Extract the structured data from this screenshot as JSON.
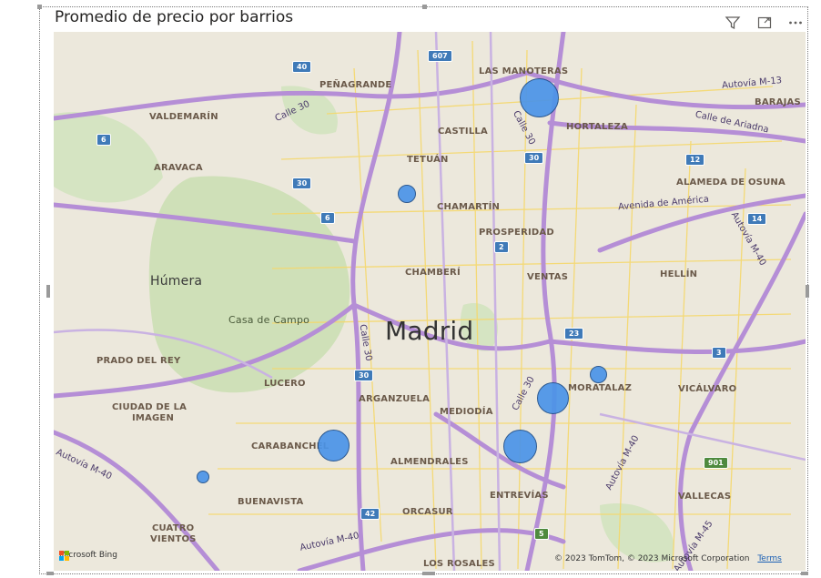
{
  "visual": {
    "title": "Promedio de precio por barrios",
    "header_icons": [
      "filter-icon",
      "focus-mode-icon",
      "more-options-icon"
    ]
  },
  "map": {
    "city_label": "Madrid",
    "place_labels": {
      "humera": "Húmera",
      "casa_de_campo": "Casa de Campo"
    },
    "districts": {
      "penagrande": "PEÑAGRANDE",
      "las_manoteras": "LAS MANOTERAS",
      "valdemarin": "VALDEMARÍN",
      "castilla": "CASTILLA",
      "hortaleza": "HORTALEZA",
      "aravaca": "ARAVACA",
      "tetuan": "TETUÁN",
      "barajas": "BARAJAS",
      "alameda_de_osuna": "ALAMEDA DE OSUNA",
      "chamartin": "CHAMARTÍN",
      "prosperidad": "PROSPERIDAD",
      "chamberi": "CHAMBERÍ",
      "ventas": "VENTAS",
      "hellin": "HELLÍN",
      "prado_del_rey": "PRADO DEL REY",
      "lucero": "LUCERO",
      "moratalaz": "MORATALAZ",
      "vicalvaro": "VICÁLVARO",
      "arganzuela": "ARGANZUELA",
      "ciudad_de_la_imagen_1": "CIUDAD DE LA",
      "ciudad_de_la_imagen_2": "IMAGEN",
      "mediodia": "MEDIODÍA",
      "carabanchel": "CARABANCHEL",
      "almendrales": "ALMENDRALES",
      "entrevias": "ENTREVÍAS",
      "buenavista": "BUENAVISTA",
      "vallecas": "VALLECAS",
      "orcasur": "ORCASUR",
      "cuatro_vientos_1": "CUATRO",
      "cuatro_vientos_2": "VIENTOS",
      "los_rosales": "LOS ROSALES"
    },
    "road_names": {
      "calle30_nw": "Calle 30",
      "calle30_ne": "Calle 30",
      "calle30_center": "Calle 30",
      "calle30_se": "Calle 30",
      "autovia_m13": "Autovía M-13",
      "calle_ariadna": "Calle de Ariadna",
      "avenida_america": "Avenida de América",
      "autovia_m40_e": "Autovía M-40",
      "autovia_m40_w": "Autovía M-40",
      "autovia_m40_s": "Autovía M-40",
      "autovia_m40_se": "Autovía M-40",
      "autovia_m45": "Autovía M-45"
    },
    "shields": {
      "s607": "607",
      "s40": "40",
      "s6a": "6",
      "s30a": "30",
      "s30b": "30",
      "s6b": "6",
      "s12": "12",
      "s2": "2",
      "s14": "14",
      "s23": "23",
      "s3": "3",
      "s30c": "30",
      "s901": "901",
      "s42": "42",
      "s5": "5"
    },
    "bubbles": [
      {
        "name": "Las Manoteras",
        "size": "large"
      },
      {
        "name": "Tetuán",
        "size": "small"
      },
      {
        "name": "Moratalaz north",
        "size": "small"
      },
      {
        "name": "Moratalaz",
        "size": "medium"
      },
      {
        "name": "Carabanchel",
        "size": "medium"
      },
      {
        "name": "Entrevías",
        "size": "medium"
      },
      {
        "name": "Cuatro Vientos",
        "size": "tiny"
      }
    ],
    "bubble_color": "#4b94e8",
    "bing_logo": "Microsoft Bing",
    "copyright": "© 2023 TomTom, © 2023 Microsoft Corporation",
    "terms": "Terms"
  }
}
